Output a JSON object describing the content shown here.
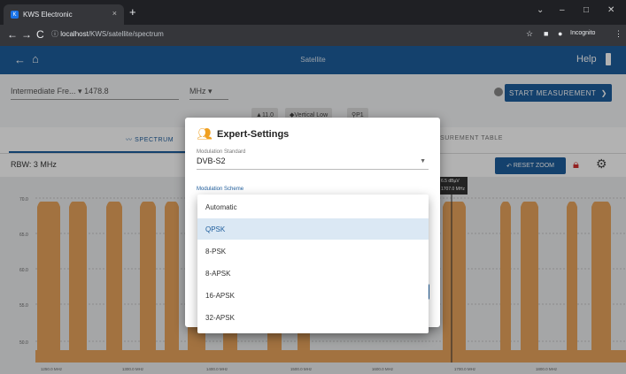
{
  "browser": {
    "tab_title": "KWS Electronic",
    "tab_close": "×",
    "new_tab": "+",
    "url_host": "localhost",
    "url_path": "/KWS/satellite/spectrum",
    "incognito_label": "Incognito",
    "window_controls": [
      "⌄",
      "–",
      "□",
      "✕"
    ]
  },
  "appbar": {
    "title": "Satellite",
    "help": "Help"
  },
  "controls": {
    "frequency_mode": "Intermediate Fre...",
    "frequency_value": "1478.8",
    "unit": "MHz",
    "start_button": "START MEASUREMENT",
    "chips": [
      "11.0",
      "Vertical Low",
      "P1"
    ]
  },
  "view_tabs": {
    "spectrum": "SPECTRUM",
    "measurement_table": "MEASUREMENT TABLE"
  },
  "spectrum": {
    "rbw": "RBW: 3 MHz",
    "reset_zoom": "RESET ZOOM",
    "marker_line1": "6.5 dBµV",
    "marker_line2": "1707.0 MHz",
    "y_ticks": [
      "70.0",
      "65.0",
      "60.0",
      "55.0",
      "50.0"
    ],
    "x_ticks": [
      "1250.0 MHz",
      "1300.0 MHz",
      "1400.0 MHz",
      "1500.0 MHz",
      "1600.0 MHz",
      "1700.0 MHz",
      "1800.0 MHz"
    ]
  },
  "chart_data": {
    "type": "area",
    "title": "",
    "xlabel": "",
    "ylabel": "",
    "series": [
      {
        "values": []
      }
    ]
  },
  "dialog": {
    "title": "Expert-Settings",
    "field1_label": "Modulation Standard",
    "field1_value": "DVB-S2",
    "field2_label": "Modulation Scheme",
    "options": [
      "Automatic",
      "QPSK",
      "8-PSK",
      "8-APSK",
      "16-APSK",
      "32-APSK"
    ],
    "selected_option": "QPSK"
  },
  "colors": {
    "primary": "#1e5d9c",
    "spectrum_fill": "#e8a45c",
    "lock": "#d32f2f"
  }
}
